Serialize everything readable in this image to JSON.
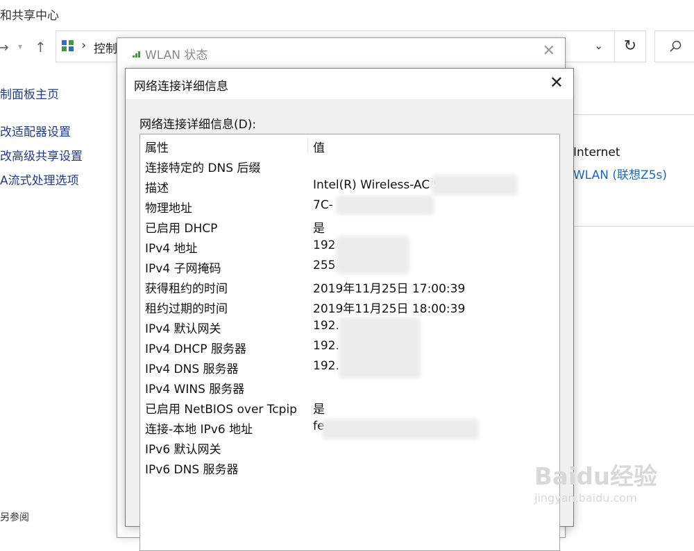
{
  "explorer": {
    "window_title": "和共享中心",
    "address_text": "控制",
    "left_nav": [
      "制面板主页",
      "改适配器设置",
      "改高级共享设置",
      "A流式处理选项"
    ],
    "bottom_text": "另参阅",
    "right_panel": {
      "internet": "Internet",
      "connection": "WLAN (联想Z5s)"
    }
  },
  "wlan_dialog": {
    "title": "WLAN 状态"
  },
  "details_dialog": {
    "title": "网络连接详细信息",
    "list_label": "网络连接详细信息(D):",
    "columns": {
      "property": "属性",
      "value": "值"
    },
    "rows": [
      {
        "property": "连接特定的 DNS 后缀",
        "value": ""
      },
      {
        "property": "描述",
        "value": "Intel(R) Wireless-AC 9"
      },
      {
        "property": "物理地址",
        "value": "7C-"
      },
      {
        "property": "已启用 DHCP",
        "value": "是"
      },
      {
        "property": "IPv4 地址",
        "value": "192"
      },
      {
        "property": "IPv4 子网掩码",
        "value": "255"
      },
      {
        "property": "获得租约的时间",
        "value": "2019年11月25日 17:00:39"
      },
      {
        "property": "租约过期的时间",
        "value": "2019年11月25日 18:00:39"
      },
      {
        "property": "IPv4 默认网关",
        "value": "192."
      },
      {
        "property": "IPv4 DHCP 服务器",
        "value": "192."
      },
      {
        "property": "IPv4 DNS 服务器",
        "value": "192."
      },
      {
        "property": "IPv4 WINS 服务器",
        "value": ""
      },
      {
        "property": "已启用 NetBIOS over Tcpip",
        "value": "是"
      },
      {
        "property": "连接-本地 IPv6 地址",
        "value": "fe"
      },
      {
        "property": "IPv6 默认网关",
        "value": ""
      },
      {
        "property": "IPv6 DNS 服务器",
        "value": ""
      }
    ]
  },
  "watermark": {
    "brand": "Baidu经验",
    "url": "jingyan.baidu.com"
  },
  "icons": [
    "back-arrow-icon",
    "forward-arrow-icon",
    "chevron-down-icon",
    "up-arrow-icon",
    "control-panel-icon",
    "refresh-icon",
    "search-icon",
    "wifi-signal-icon",
    "close-icon"
  ]
}
